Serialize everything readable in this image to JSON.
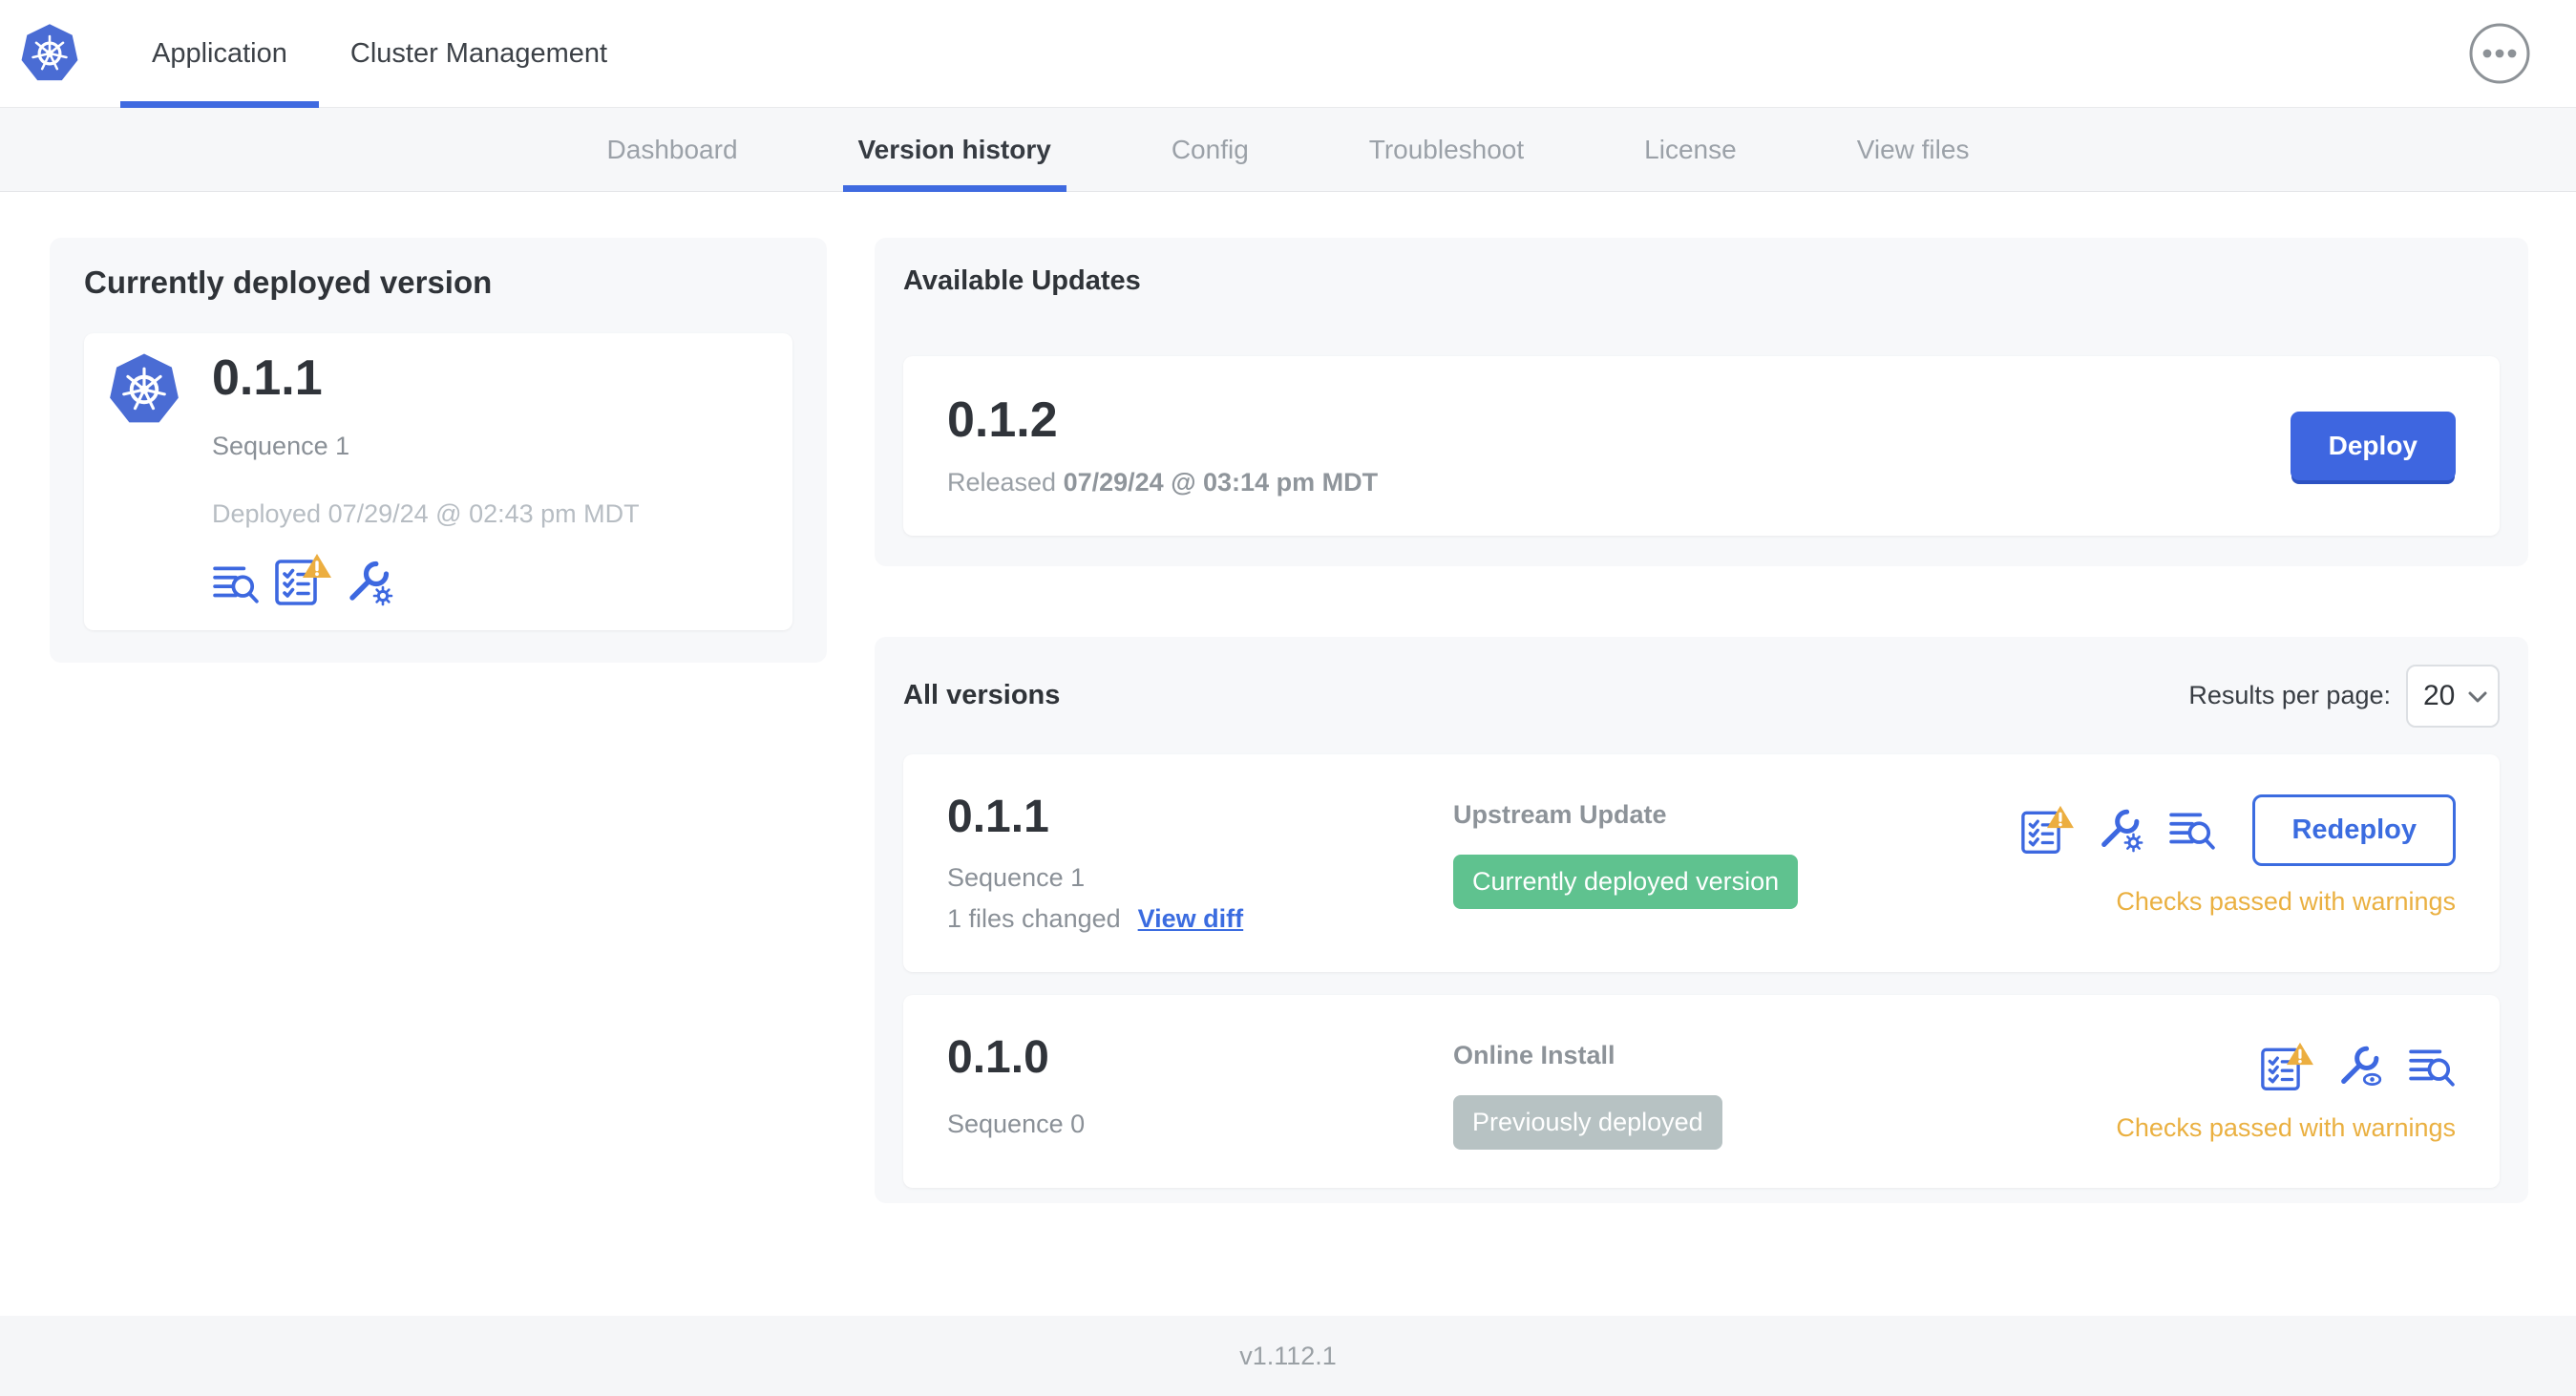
{
  "topbar": {
    "tabs": [
      {
        "label": "Application",
        "active": true
      },
      {
        "label": "Cluster Management",
        "active": false
      }
    ],
    "more_menu_icon": "ellipsis-circle-icon"
  },
  "subnav": {
    "tabs": [
      {
        "label": "Dashboard",
        "active": false
      },
      {
        "label": "Version history",
        "active": true
      },
      {
        "label": "Config",
        "active": false
      },
      {
        "label": "Troubleshoot",
        "active": false
      },
      {
        "label": "License",
        "active": false
      },
      {
        "label": "View files",
        "active": false
      }
    ]
  },
  "current_version": {
    "title": "Currently deployed version",
    "version": "0.1.1",
    "sequence": "Sequence 1",
    "deployed": "Deployed 07/29/24 @ 02:43 pm MDT",
    "icons": [
      "logs-icon",
      "preflight-checks-warning-icon",
      "edit-config-icon"
    ]
  },
  "available_updates": {
    "title": "Available Updates",
    "version": "0.1.2",
    "released_prefix": "Released",
    "released_date": "07/29/24 @ 03:14 pm MDT",
    "deploy_label": "Deploy"
  },
  "all_versions": {
    "title": "All versions",
    "results_per_page_label": "Results per page:",
    "results_per_page_value": "20",
    "rows": [
      {
        "version": "0.1.1",
        "sequence": "Sequence 1",
        "files_changed": "1 files changed",
        "view_diff_label": "View diff",
        "source": "Upstream Update",
        "badge": {
          "label": "Currently deployed version",
          "color": "#5fc28f"
        },
        "status": "Checks passed with warnings",
        "action_label": "Redeploy",
        "icons": [
          "preflight-checks-warning-icon",
          "edit-config-icon",
          "logs-icon"
        ]
      },
      {
        "version": "0.1.0",
        "sequence": "Sequence 0",
        "source": "Online Install",
        "badge": {
          "label": "Previously deployed",
          "color": "#b7c2c3"
        },
        "status": "Checks passed with warnings",
        "icons": [
          "preflight-checks-warning-icon",
          "view-config-icon",
          "logs-icon"
        ]
      }
    ]
  },
  "footer": {
    "app_version": "v1.112.1"
  },
  "colors": {
    "accent_blue": "#3d68e0",
    "badge_green": "#5fc28f",
    "badge_gray": "#b7c2c3",
    "warning_orange": "#ecae40",
    "logo_blue": "#4a6cd4"
  }
}
